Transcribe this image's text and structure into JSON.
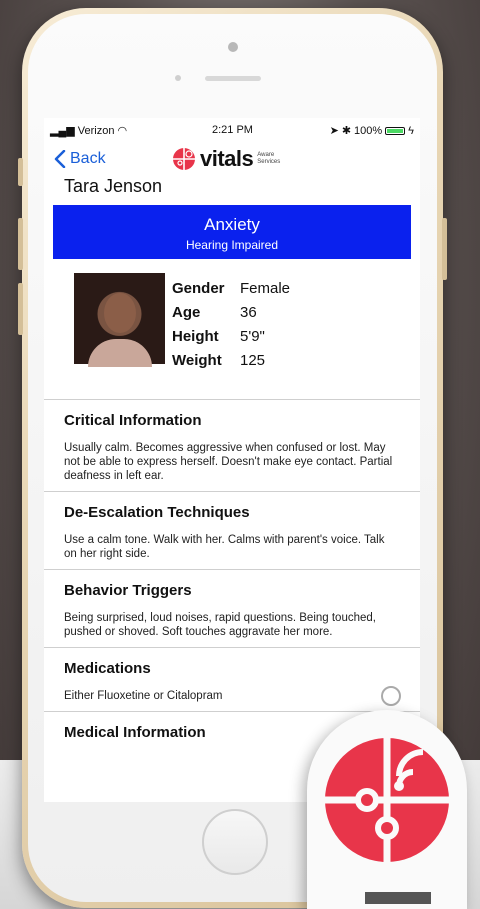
{
  "status_bar": {
    "carrier": "Verizon",
    "time": "2:21 PM",
    "battery": "100%"
  },
  "nav": {
    "back_label": "Back",
    "logo_text": "vitals",
    "logo_sub_line1": "Aware",
    "logo_sub_line2": "Services"
  },
  "person": {
    "name": "Tara Jenson",
    "condition": "Anxiety",
    "sub_condition": "Hearing Impaired",
    "stats": [
      {
        "label": "Gender",
        "value": "Female"
      },
      {
        "label": "Age",
        "value": "36"
      },
      {
        "label": "Height",
        "value": "5'9\""
      },
      {
        "label": "Weight",
        "value": "125"
      }
    ]
  },
  "sections": [
    {
      "title": "Critical Information",
      "body": "Usually calm.  Becomes aggressive when confused or lost.  May not be able to express herself.  Doesn't make eye contact.  Partial deafness in left ear."
    },
    {
      "title": "De-Escalation Techniques",
      "body": "Use a calm tone.  Walk with her.  Calms with parent's voice.  Talk on her right side."
    },
    {
      "title": "Behavior Triggers",
      "body": "Being surprised, loud noises, rapid questions.  Being touched, pushed or shoved.  Soft touches aggravate her more."
    },
    {
      "title": "Medications",
      "body": "Either Fluoxetine or Citalopram"
    },
    {
      "title": "Medical Information",
      "body": ""
    }
  ],
  "colors": {
    "banner": "#0a21ee",
    "link": "#1a5fd8",
    "brand_red": "#e8354a"
  }
}
